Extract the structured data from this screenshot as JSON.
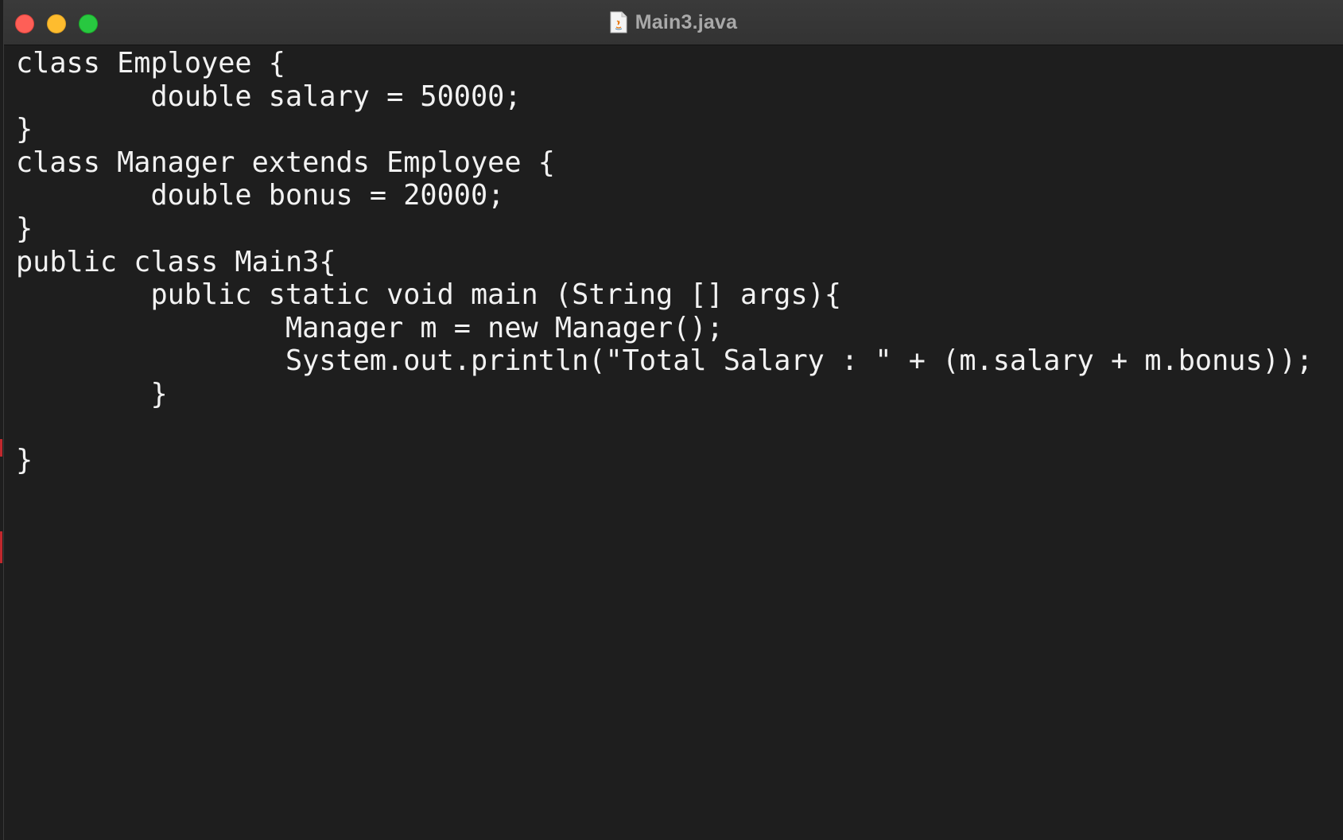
{
  "window": {
    "title": "Main3.java",
    "file_icon": "java-file-icon"
  },
  "editor": {
    "lines": [
      "class Employee {",
      "        double salary = 50000;",
      "}",
      "class Manager extends Employee {",
      "        double bonus = 20000;",
      "}",
      "public class Main3{",
      "        public static void main (String [] args){",
      "                Manager m = new Manager();",
      "                System.out.println(\"Total Salary : \" + (m.salary + m.bonus));",
      "        }",
      "",
      "}"
    ]
  },
  "colors": {
    "background": "#1e1e1e",
    "text": "#f2f2f2",
    "titlebar": "#363636",
    "title_text": "#a9a9a9",
    "close": "#fe5f57",
    "minimize": "#febc2e",
    "zoom": "#28c840"
  }
}
